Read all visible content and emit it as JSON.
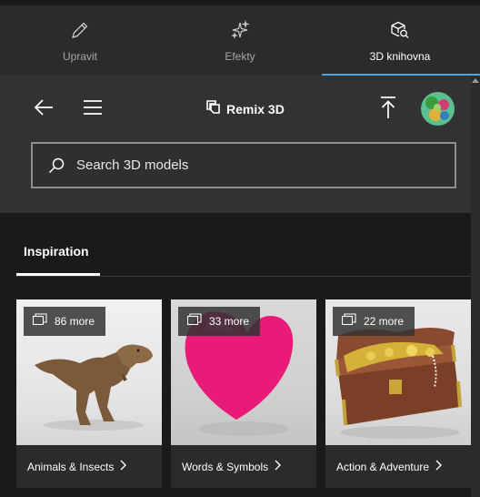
{
  "tabs": [
    {
      "label": "Upravit",
      "icon": "pencil-icon",
      "active": false
    },
    {
      "label": "Efekty",
      "icon": "sparkle-icon",
      "active": false
    },
    {
      "label": "3D knihovna",
      "icon": "cube-search-icon",
      "active": true
    }
  ],
  "header": {
    "brand": "Remix 3D",
    "back_icon": "back-arrow-icon",
    "menu_icon": "hamburger-menu-icon",
    "upload_icon": "upload-icon"
  },
  "search": {
    "placeholder": "Search 3D models"
  },
  "section_tab": "Inspiration",
  "cards": [
    {
      "count": "86 more",
      "label": "Animals & Insects",
      "image": "t-rex-model"
    },
    {
      "count": "33 more",
      "label": "Words & Symbols",
      "image": "pink-heart-model"
    },
    {
      "count": "22 more",
      "label": "Action & Adventure",
      "image": "treasure-chest-model"
    }
  ],
  "colors": {
    "accent": "#4ea4e0",
    "tab_bar": "#2b2b2b",
    "panel": "#323232",
    "background": "#1b1a19"
  }
}
